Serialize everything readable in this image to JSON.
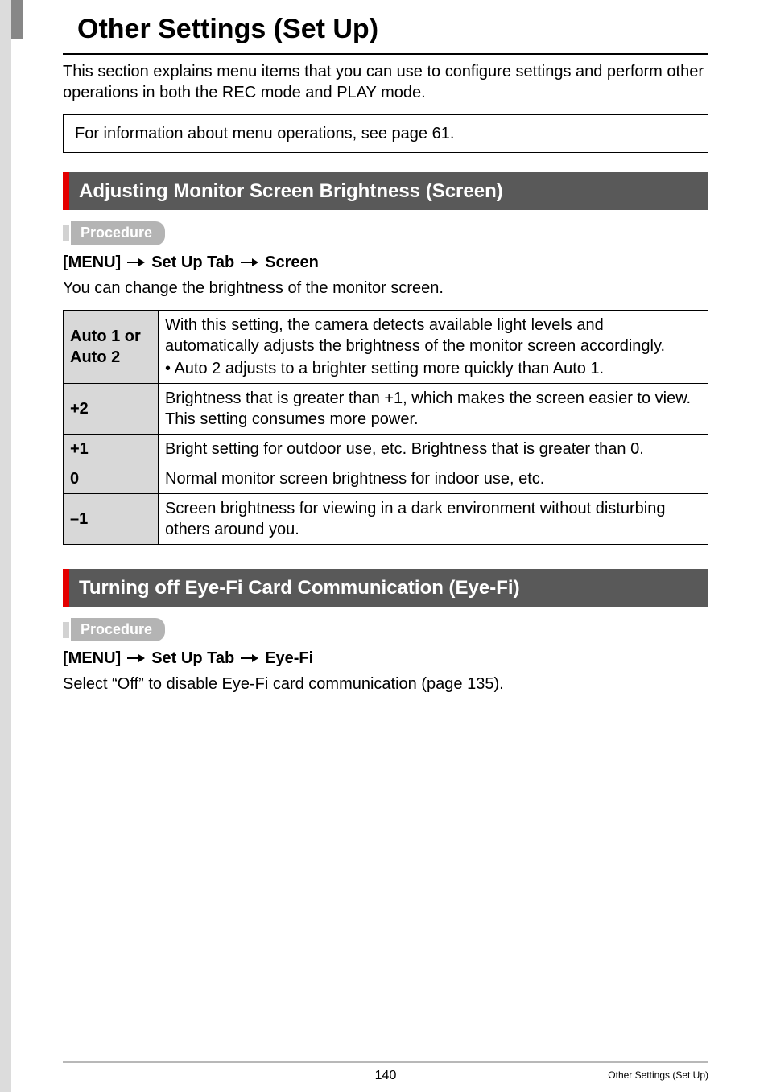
{
  "title": "Other Settings (Set Up)",
  "intro": "This section explains menu items that you can use to configure settings and perform other operations in both the REC mode and PLAY mode.",
  "info_box": "For information about menu operations, see page 61.",
  "procedure_label": "Procedure",
  "section1": {
    "heading": "Adjusting Monitor Screen Brightness (Screen)",
    "path": {
      "p1": "[MENU]",
      "p2": "Set Up Tab",
      "p3": "Screen"
    },
    "desc": "You can change the brightness of the monitor screen.",
    "rows": [
      {
        "option": "Auto 1 or Auto 2",
        "text": "With this setting, the camera detects available light levels and automatically adjusts the brightness of the monitor screen accordingly.",
        "bullet": "Auto 2 adjusts to a brighter setting more quickly than Auto 1."
      },
      {
        "option": "+2",
        "text": "Brightness that is greater than +1, which makes the screen easier to view. This setting consumes more power."
      },
      {
        "option": "+1",
        "text": "Bright setting for outdoor use, etc. Brightness that is greater than 0."
      },
      {
        "option": "0",
        "text": "Normal monitor screen brightness for indoor use, etc."
      },
      {
        "option": "–1",
        "text": "Screen brightness for viewing in a dark environment without disturbing others around you."
      }
    ]
  },
  "section2": {
    "heading": "Turning off Eye-Fi Card Communication (Eye-Fi)",
    "path": {
      "p1": "[MENU]",
      "p2": "Set Up Tab",
      "p3": "Eye-Fi"
    },
    "desc": "Select “Off” to disable Eye-Fi card communication (page 135)."
  },
  "footer": {
    "page_number": "140",
    "section_ref": "Other Settings (Set Up)"
  }
}
